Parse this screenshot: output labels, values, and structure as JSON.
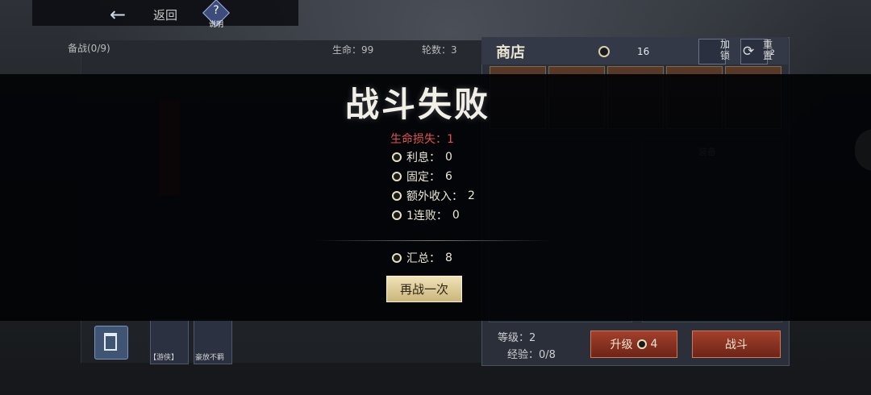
{
  "topbar": {
    "back_label": "返回",
    "help_label": "说明",
    "help_icon_glyph": "?"
  },
  "status": {
    "bench": "备战(0/9)",
    "hp": "生命：99",
    "round": "轮数：3"
  },
  "shop": {
    "title": "商店",
    "gold": "16",
    "lock_label": "加锁",
    "reset_label": "重置",
    "reset_cost": "2",
    "equip_title": "装备",
    "level": "等级：2",
    "exp": "经验：0/8",
    "upgrade_label": "升级",
    "upgrade_cost": "4",
    "battle_label": "战斗"
  },
  "bottom": {
    "sell_label": "出售",
    "traits": [
      {
        "label": "【游侠】"
      },
      {
        "label": "豪放不羁"
      }
    ]
  },
  "defeat": {
    "title": "战斗失败",
    "hp_loss": "生命损失：1",
    "rows": [
      {
        "label": "利息：",
        "value": "0"
      },
      {
        "label": "固定：",
        "value": "6"
      },
      {
        "label": "额外收入：",
        "value": "2"
      },
      {
        "label": "1连败：",
        "value": "0"
      }
    ],
    "total_label": "汇总：",
    "total_value": "8",
    "retry_label": "再战一次"
  },
  "colors": {
    "loss_red": "#e0544e",
    "button_gold": "#e6d69f",
    "button_red": "#8f3521"
  },
  "icons": [
    "back-arrow-icon",
    "help-icon",
    "coin-icon",
    "lock-icon",
    "refresh-icon",
    "trash-icon"
  ]
}
